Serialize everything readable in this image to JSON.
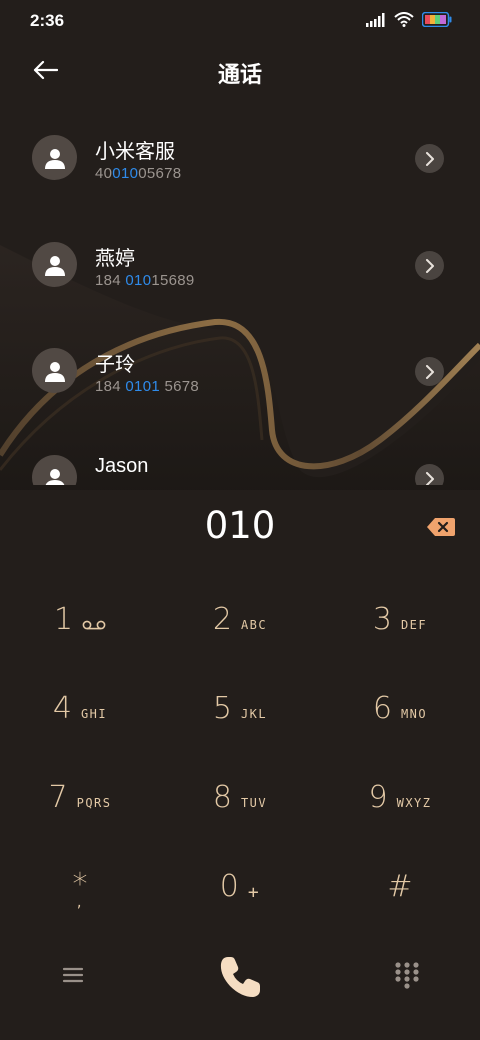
{
  "status_bar": {
    "time": "2:36",
    "icons": [
      "signal-icon",
      "wifi-icon",
      "battery-icon"
    ]
  },
  "header": {
    "title": "通话",
    "back_icon": "back-arrow-icon"
  },
  "contacts": [
    {
      "name": "小米客服",
      "number_pre": "40",
      "number_match": "010",
      "number_post": "05678"
    },
    {
      "name": "燕婷",
      "number_pre": "184 ",
      "number_match": "010",
      "number_post": "15689"
    },
    {
      "name": "子玲",
      "number_pre": "184 ",
      "number_match": "0101",
      "number_post": " 5678"
    },
    {
      "name": "Jason",
      "number_pre": "",
      "number_match": "",
      "number_post": ""
    }
  ],
  "dial_input": {
    "value": "010",
    "delete_icon": "backspace-icon"
  },
  "keypad": [
    {
      "digit": "1",
      "letters": "",
      "icon": "voicemail-icon"
    },
    {
      "digit": "2",
      "letters": "ABC"
    },
    {
      "digit": "3",
      "letters": "DEF"
    },
    {
      "digit": "4",
      "letters": "GHI"
    },
    {
      "digit": "5",
      "letters": "JKL"
    },
    {
      "digit": "6",
      "letters": "MNO"
    },
    {
      "digit": "7",
      "letters": "PQRS"
    },
    {
      "digit": "8",
      "letters": "TUV"
    },
    {
      "digit": "9",
      "letters": "WXYZ"
    },
    {
      "digit": "*",
      "letters": ","
    },
    {
      "digit": "0",
      "letters": "+"
    },
    {
      "digit": "#",
      "letters": ""
    }
  ],
  "bottom_bar": {
    "icons": [
      "menu-icon",
      "call-icon",
      "dialpad-icon"
    ]
  },
  "colors": {
    "background": "#231e1b",
    "key_text": "#e3c9a6",
    "match_highlight": "#2f8bea",
    "call_button": "#f5ddc2",
    "delete_button": "#f0a36d"
  }
}
